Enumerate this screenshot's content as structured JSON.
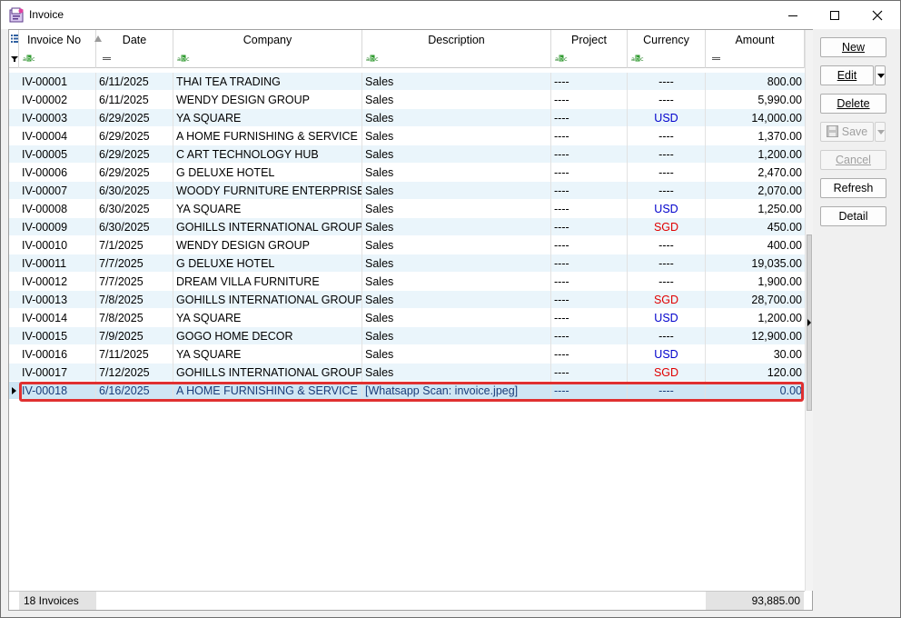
{
  "window": {
    "title": "Invoice"
  },
  "grid": {
    "columns": [
      {
        "key": "no",
        "label": "Invoice No",
        "filter": "abc"
      },
      {
        "key": "date",
        "label": "Date",
        "filter": "eq"
      },
      {
        "key": "company",
        "label": "Company",
        "filter": "abc"
      },
      {
        "key": "desc",
        "label": "Description",
        "filter": "abc"
      },
      {
        "key": "project",
        "label": "Project",
        "filter": "abc"
      },
      {
        "key": "currency",
        "label": "Currency",
        "filter": "abc"
      },
      {
        "key": "amount",
        "label": "Amount",
        "filter": "eq"
      }
    ],
    "rows": [
      {
        "no": "IV-00001",
        "date": "6/11/2025",
        "company": "THAI TEA TRADING",
        "desc": "Sales",
        "project": "----",
        "currency": "----",
        "amount": "800.00"
      },
      {
        "no": "IV-00002",
        "date": "6/11/2025",
        "company": "WENDY DESIGN GROUP",
        "desc": "Sales",
        "project": "----",
        "currency": "----",
        "amount": "5,990.00"
      },
      {
        "no": "IV-00003",
        "date": "6/29/2025",
        "company": "YA SQUARE",
        "desc": "Sales",
        "project": "----",
        "currency": "USD",
        "amount": "14,000.00"
      },
      {
        "no": "IV-00004",
        "date": "6/29/2025",
        "company": "A HOME FURNISHING & SERVICE",
        "desc": "Sales",
        "project": "----",
        "currency": "----",
        "amount": "1,370.00"
      },
      {
        "no": "IV-00005",
        "date": "6/29/2025",
        "company": "C ART TECHNOLOGY HUB",
        "desc": "Sales",
        "project": "----",
        "currency": "----",
        "amount": "1,200.00"
      },
      {
        "no": "IV-00006",
        "date": "6/29/2025",
        "company": "G DELUXE HOTEL",
        "desc": "Sales",
        "project": "----",
        "currency": "----",
        "amount": "2,470.00"
      },
      {
        "no": "IV-00007",
        "date": "6/30/2025",
        "company": "WOODY FURNITURE ENTERPRISE",
        "desc": "Sales",
        "project": "----",
        "currency": "----",
        "amount": "2,070.00"
      },
      {
        "no": "IV-00008",
        "date": "6/30/2025",
        "company": "YA SQUARE",
        "desc": "Sales",
        "project": "----",
        "currency": "USD",
        "amount": "1,250.00"
      },
      {
        "no": "IV-00009",
        "date": "6/30/2025",
        "company": "GOHILLS INTERNATIONAL GROUP",
        "desc": "Sales",
        "project": "----",
        "currency": "SGD",
        "amount": "450.00"
      },
      {
        "no": "IV-00010",
        "date": "7/1/2025",
        "company": "WENDY DESIGN GROUP",
        "desc": "Sales",
        "project": "----",
        "currency": "----",
        "amount": "400.00"
      },
      {
        "no": "IV-00011",
        "date": "7/7/2025",
        "company": "G DELUXE HOTEL",
        "desc": "Sales",
        "project": "----",
        "currency": "----",
        "amount": "19,035.00"
      },
      {
        "no": "IV-00012",
        "date": "7/7/2025",
        "company": "DREAM VILLA FURNITURE",
        "desc": "Sales",
        "project": "----",
        "currency": "----",
        "amount": "1,900.00"
      },
      {
        "no": "IV-00013",
        "date": "7/8/2025",
        "company": "GOHILLS INTERNATIONAL GROUP",
        "desc": "Sales",
        "project": "----",
        "currency": "SGD",
        "amount": "28,700.00"
      },
      {
        "no": "IV-00014",
        "date": "7/8/2025",
        "company": "YA SQUARE",
        "desc": "Sales",
        "project": "----",
        "currency": "USD",
        "amount": "1,200.00"
      },
      {
        "no": "IV-00015",
        "date": "7/9/2025",
        "company": "GOGO HOME DECOR",
        "desc": "Sales",
        "project": "----",
        "currency": "----",
        "amount": "12,900.00"
      },
      {
        "no": "IV-00016",
        "date": "7/11/2025",
        "company": "YA SQUARE",
        "desc": "Sales",
        "project": "----",
        "currency": "USD",
        "amount": "30.00"
      },
      {
        "no": "IV-00017",
        "date": "7/12/2025",
        "company": "GOHILLS INTERNATIONAL GROUP",
        "desc": "Sales",
        "project": "----",
        "currency": "SGD",
        "amount": "120.00"
      },
      {
        "no": "IV-00018",
        "date": "6/16/2025",
        "company": "A HOME FURNISHING & SERVICE",
        "desc": "[Whatsapp Scan: invoice.jpeg]",
        "project": "----",
        "currency": "----",
        "amount": "0.00"
      }
    ],
    "selected_row": 17,
    "footer": {
      "count": "18 Invoices",
      "total": "93,885.00"
    }
  },
  "buttons": {
    "new": "New",
    "edit": "Edit",
    "delete": "Delete",
    "save": "Save",
    "cancel": "Cancel",
    "refresh": "Refresh",
    "detail": "Detail"
  },
  "colors": {
    "usd": "#0000cc",
    "sgd": "#e00000",
    "highlight": "#e03030",
    "alt_row": "#eaf5fb"
  }
}
